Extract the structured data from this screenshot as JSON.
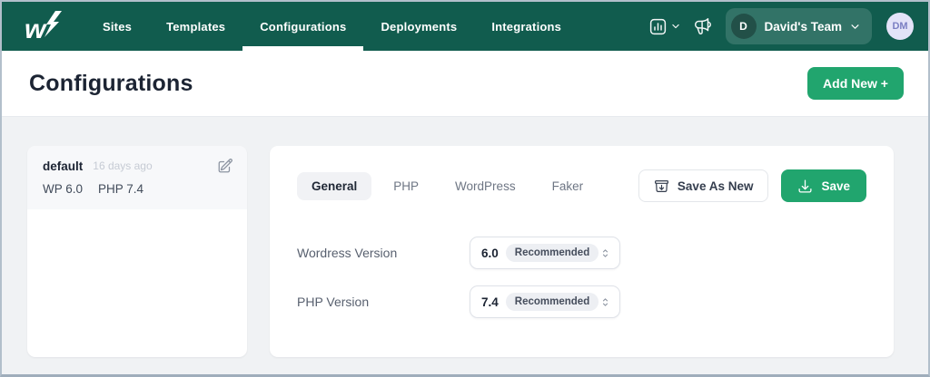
{
  "colors": {
    "navbar_bg": "#115c4e",
    "accent_green": "#21a56e",
    "page_bg": "#f0f2f4",
    "title_color": "#1c2433",
    "user_avatar_bg": "#e3e3f8"
  },
  "navbar": {
    "items": [
      {
        "label": "Sites",
        "active": false
      },
      {
        "label": "Templates",
        "active": false
      },
      {
        "label": "Configurations",
        "active": true
      },
      {
        "label": "Deployments",
        "active": false
      },
      {
        "label": "Integrations",
        "active": false
      }
    ],
    "team": {
      "initial": "D",
      "name": "David's Team"
    },
    "user_initials": "DM"
  },
  "header": {
    "title": "Configurations",
    "add_new_label": "Add New +"
  },
  "sidebar": {
    "items": [
      {
        "name": "default",
        "age": "16 days ago",
        "wp": "WP 6.0",
        "php": "PHP 7.4",
        "selected": true
      }
    ]
  },
  "panel": {
    "tabs": [
      {
        "label": "General",
        "active": true
      },
      {
        "label": "PHP",
        "active": false
      },
      {
        "label": "WordPress",
        "active": false
      },
      {
        "label": "Faker",
        "active": false
      }
    ],
    "save_as_new_label": "Save As New",
    "save_label": "Save",
    "fields": [
      {
        "label": "Wordress Version",
        "value": "6.0",
        "badge": "Recommended"
      },
      {
        "label": "PHP Version",
        "value": "7.4",
        "badge": "Recommended"
      }
    ]
  }
}
